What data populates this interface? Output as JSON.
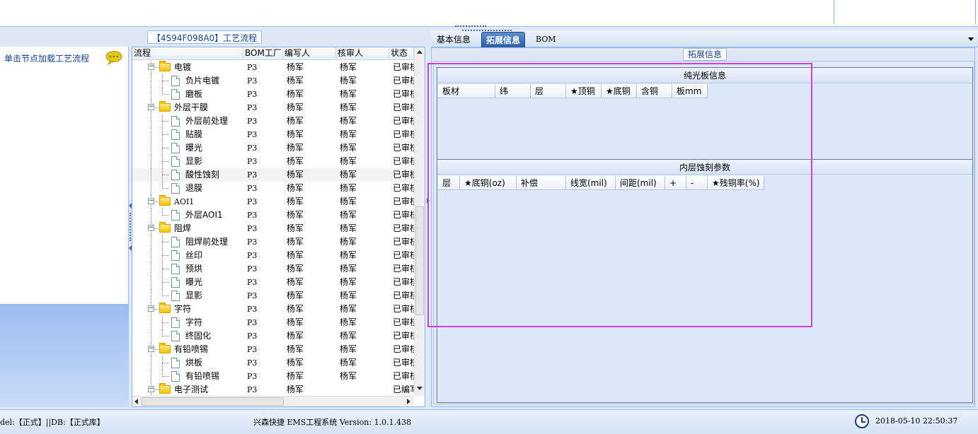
{
  "left_panel": {
    "hint": "单击节点加载工艺流程",
    "bubble_icon": "speech-bubble-icon"
  },
  "process": {
    "title": "【4S94F098A0】工艺流程",
    "columns": [
      "流程",
      "BOM工厂",
      "编写人",
      "核审人",
      "状态"
    ],
    "rows": [
      {
        "name": "电镀",
        "type": "folder",
        "level": 1,
        "factory": "P3",
        "writer": "杨军",
        "reviewer": "杨军",
        "status": "已审核"
      },
      {
        "name": "负片电镀",
        "type": "doc",
        "level": 2,
        "factory": "P3",
        "writer": "杨军",
        "reviewer": "杨军",
        "status": "已审核"
      },
      {
        "name": "磨板",
        "type": "doc",
        "level": 2,
        "last": true,
        "factory": "P3",
        "writer": "杨军",
        "reviewer": "杨军",
        "status": "已审核"
      },
      {
        "name": "外层干膜",
        "type": "folder",
        "level": 1,
        "factory": "P3",
        "writer": "杨军",
        "reviewer": "杨军",
        "status": "已审核"
      },
      {
        "name": "外层前处理",
        "type": "doc",
        "level": 2,
        "factory": "P3",
        "writer": "杨军",
        "reviewer": "杨军",
        "status": "已审核"
      },
      {
        "name": "贴膜",
        "type": "doc",
        "level": 2,
        "factory": "P3",
        "writer": "杨军",
        "reviewer": "杨军",
        "status": "已审核"
      },
      {
        "name": "曝光",
        "type": "doc",
        "level": 2,
        "factory": "P3",
        "writer": "杨军",
        "reviewer": "杨军",
        "status": "已审核"
      },
      {
        "name": "显影",
        "type": "doc",
        "level": 2,
        "factory": "P3",
        "writer": "杨军",
        "reviewer": "杨军",
        "status": "已审核"
      },
      {
        "name": "酸性蚀刻",
        "type": "doc",
        "level": 2,
        "selected": true,
        "factory": "P3",
        "writer": "杨军",
        "reviewer": "杨军",
        "status": "已审核"
      },
      {
        "name": "退膜",
        "type": "doc",
        "level": 2,
        "last": true,
        "factory": "P3",
        "writer": "杨军",
        "reviewer": "杨军",
        "status": "已审核"
      },
      {
        "name": "AOI1",
        "type": "folder",
        "level": 1,
        "code": true,
        "factory": "P3",
        "writer": "杨军",
        "reviewer": "杨军",
        "status": "已审核"
      },
      {
        "name": "外层AOI1",
        "type": "doc",
        "level": 2,
        "last": true,
        "factory": "P3",
        "writer": "杨军",
        "reviewer": "杨军",
        "status": "已审核"
      },
      {
        "name": "阻焊",
        "type": "folder",
        "level": 1,
        "factory": "P3",
        "writer": "杨军",
        "reviewer": "杨军",
        "status": "已审核"
      },
      {
        "name": "阻焊前处理",
        "type": "doc",
        "level": 2,
        "factory": "P3",
        "writer": "杨军",
        "reviewer": "杨军",
        "status": "已审核"
      },
      {
        "name": "丝印",
        "type": "doc",
        "level": 2,
        "factory": "P3",
        "writer": "杨军",
        "reviewer": "杨军",
        "status": "已审核"
      },
      {
        "name": "预烘",
        "type": "doc",
        "level": 2,
        "factory": "P3",
        "writer": "杨军",
        "reviewer": "杨军",
        "status": "已审核"
      },
      {
        "name": "曝光",
        "type": "doc",
        "level": 2,
        "factory": "P3",
        "writer": "杨军",
        "reviewer": "杨军",
        "status": "已审核"
      },
      {
        "name": "显影",
        "type": "doc",
        "level": 2,
        "last": true,
        "factory": "P3",
        "writer": "杨军",
        "reviewer": "杨军",
        "status": "已审核"
      },
      {
        "name": "字符",
        "type": "folder",
        "level": 1,
        "factory": "P3",
        "writer": "杨军",
        "reviewer": "杨军",
        "status": "已审核"
      },
      {
        "name": "字符",
        "type": "doc",
        "level": 2,
        "factory": "P3",
        "writer": "杨军",
        "reviewer": "杨军",
        "status": "已审核"
      },
      {
        "name": "终固化",
        "type": "doc",
        "level": 2,
        "last": true,
        "factory": "P3",
        "writer": "杨军",
        "reviewer": "杨军",
        "status": "已审核"
      },
      {
        "name": "有铅喷锡",
        "type": "folder",
        "level": 1,
        "factory": "P3",
        "writer": "杨军",
        "reviewer": "杨军",
        "status": "已审核"
      },
      {
        "name": "烘板",
        "type": "doc",
        "level": 2,
        "factory": "P3",
        "writer": "杨军",
        "reviewer": "杨军",
        "status": "已审核"
      },
      {
        "name": "有铅喷锡",
        "type": "doc",
        "level": 2,
        "last": true,
        "factory": "P3",
        "writer": "杨军",
        "reviewer": "杨军",
        "status": "已审核"
      },
      {
        "name": "电子测试",
        "type": "folder",
        "level": 1,
        "factory": "P3",
        "writer": "杨军",
        "reviewer": "",
        "status": "已编写"
      }
    ]
  },
  "tabs": [
    {
      "label": "基本信息",
      "active": false
    },
    {
      "label": "拓展信息",
      "active": true
    },
    {
      "label": "BOM",
      "active": false
    }
  ],
  "ext": {
    "label": "拓展信息",
    "section1": {
      "title": "纯光板信息",
      "columns": [
        "板材",
        "纬",
        "层",
        "★顶铜",
        "★底铜",
        "含铜",
        "板mm"
      ]
    },
    "section2": {
      "title": "内层蚀刻参数",
      "columns": [
        "层",
        "★底铜(oz)",
        "补偿",
        "线宽(mil)",
        "间距(mil)",
        "+",
        "-",
        "★残铜率(%)"
      ]
    }
  },
  "status": {
    "left": "del:【正式】||DB:【正式库】",
    "center": "兴森快捷 EMS工程系统 Version: 1.0.1.438",
    "datetime": "2018-05-10 22:50:37"
  },
  "colors": {
    "accent": "#2e5fa8",
    "highlight": "#d33dd3",
    "panel_bg": "#dfe8f6"
  }
}
